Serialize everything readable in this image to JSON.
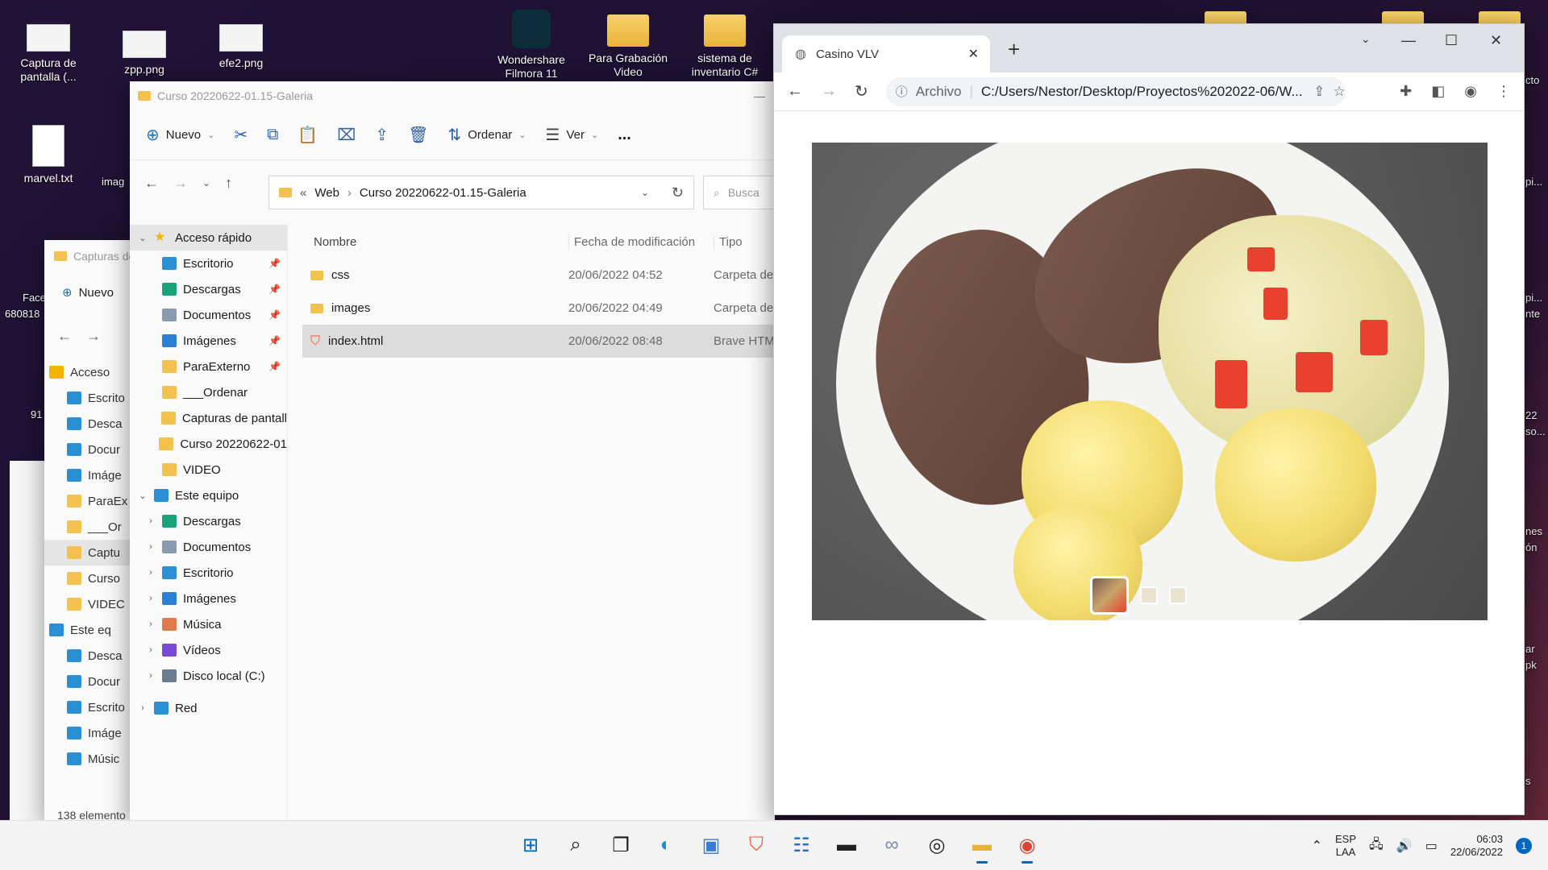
{
  "desktop": {
    "icons": [
      {
        "label": "Captura de pantalla (..."
      },
      {
        "label": "zpp.png"
      },
      {
        "label": "efe2.png"
      },
      {
        "label": "marvel.txt"
      },
      {
        "label": "Wondershare Filmora 11"
      },
      {
        "label": "Para Grabación Video"
      },
      {
        "label": "sistema de inventario C#"
      }
    ],
    "fragments": [
      "imag",
      "Face",
      "680818",
      "91",
      "cto",
      "pi...",
      "pi...",
      "nte",
      "22",
      "so...",
      "nes",
      "ón",
      "ar",
      "pk",
      "s"
    ]
  },
  "explorer": {
    "title": "Curso 20220622-01.15-Galeria",
    "commands": {
      "new": "Nuevo",
      "sort": "Ordenar",
      "view": "Ver",
      "more": "..."
    },
    "breadcrumb": {
      "prefix": "«",
      "parent": "Web",
      "current": "Curso 20220622-01.15-Galeria"
    },
    "search_placeholder": "Busca",
    "sidebar": [
      {
        "label": "Acceso rápido",
        "type": "header"
      },
      {
        "label": "Escritorio",
        "pinned": true
      },
      {
        "label": "Descargas",
        "pinned": true
      },
      {
        "label": "Documentos",
        "pinned": true
      },
      {
        "label": "Imágenes",
        "pinned": true
      },
      {
        "label": "ParaExterno",
        "pinned": true
      },
      {
        "label": "___Ordenar"
      },
      {
        "label": "Capturas de pantall"
      },
      {
        "label": "Curso 20220622-01"
      },
      {
        "label": "VIDEO"
      },
      {
        "label": "Este equipo",
        "type": "header"
      },
      {
        "label": "Descargas"
      },
      {
        "label": "Documentos"
      },
      {
        "label": "Escritorio"
      },
      {
        "label": "Imágenes"
      },
      {
        "label": "Música"
      },
      {
        "label": "Vídeos"
      },
      {
        "label": "Disco local (C:)"
      },
      {
        "label": "Red",
        "type": "header"
      }
    ],
    "columns": {
      "name": "Nombre",
      "modified": "Fecha de modificación",
      "type": "Tipo"
    },
    "files": [
      {
        "name": "css",
        "modified": "20/06/2022 04:52",
        "type": "Carpeta de"
      },
      {
        "name": "images",
        "modified": "20/06/2022 04:49",
        "type": "Carpeta de"
      },
      {
        "name": "index.html",
        "modified": "20/06/2022 08:48",
        "type": "Brave HTM"
      }
    ]
  },
  "bg_explorer": {
    "title": "Capturas de",
    "new_label": "Nuevo",
    "sidebar": [
      "Acceso",
      "Escrito",
      "Desca",
      "Docur",
      "Imáge",
      "ParaEx",
      "___Or",
      "Captu",
      "Curso",
      "VIDEC",
      "Este eq",
      "Desca",
      "Docur",
      "Escrito",
      "Imáge",
      "Músic"
    ],
    "status": "138 elemento"
  },
  "browser": {
    "tab_title": "Casino VLV",
    "scheme_label": "Archivo",
    "url": "C:/Users/Nestor/Desktop/Proyectos%202022-06/W...",
    "gallery": {
      "thumbnails": 3,
      "active_index": 0
    }
  },
  "taskbar": {
    "lang_top": "ESP",
    "lang_bottom": "LAA",
    "time": "06:03",
    "date": "22/06/2022",
    "notifications": "1"
  },
  "colors": {
    "accent": "#0067c0",
    "folder": "#f2c14e",
    "brave": "#fb542b",
    "chrome_tab_bg": "#dee1e6"
  }
}
